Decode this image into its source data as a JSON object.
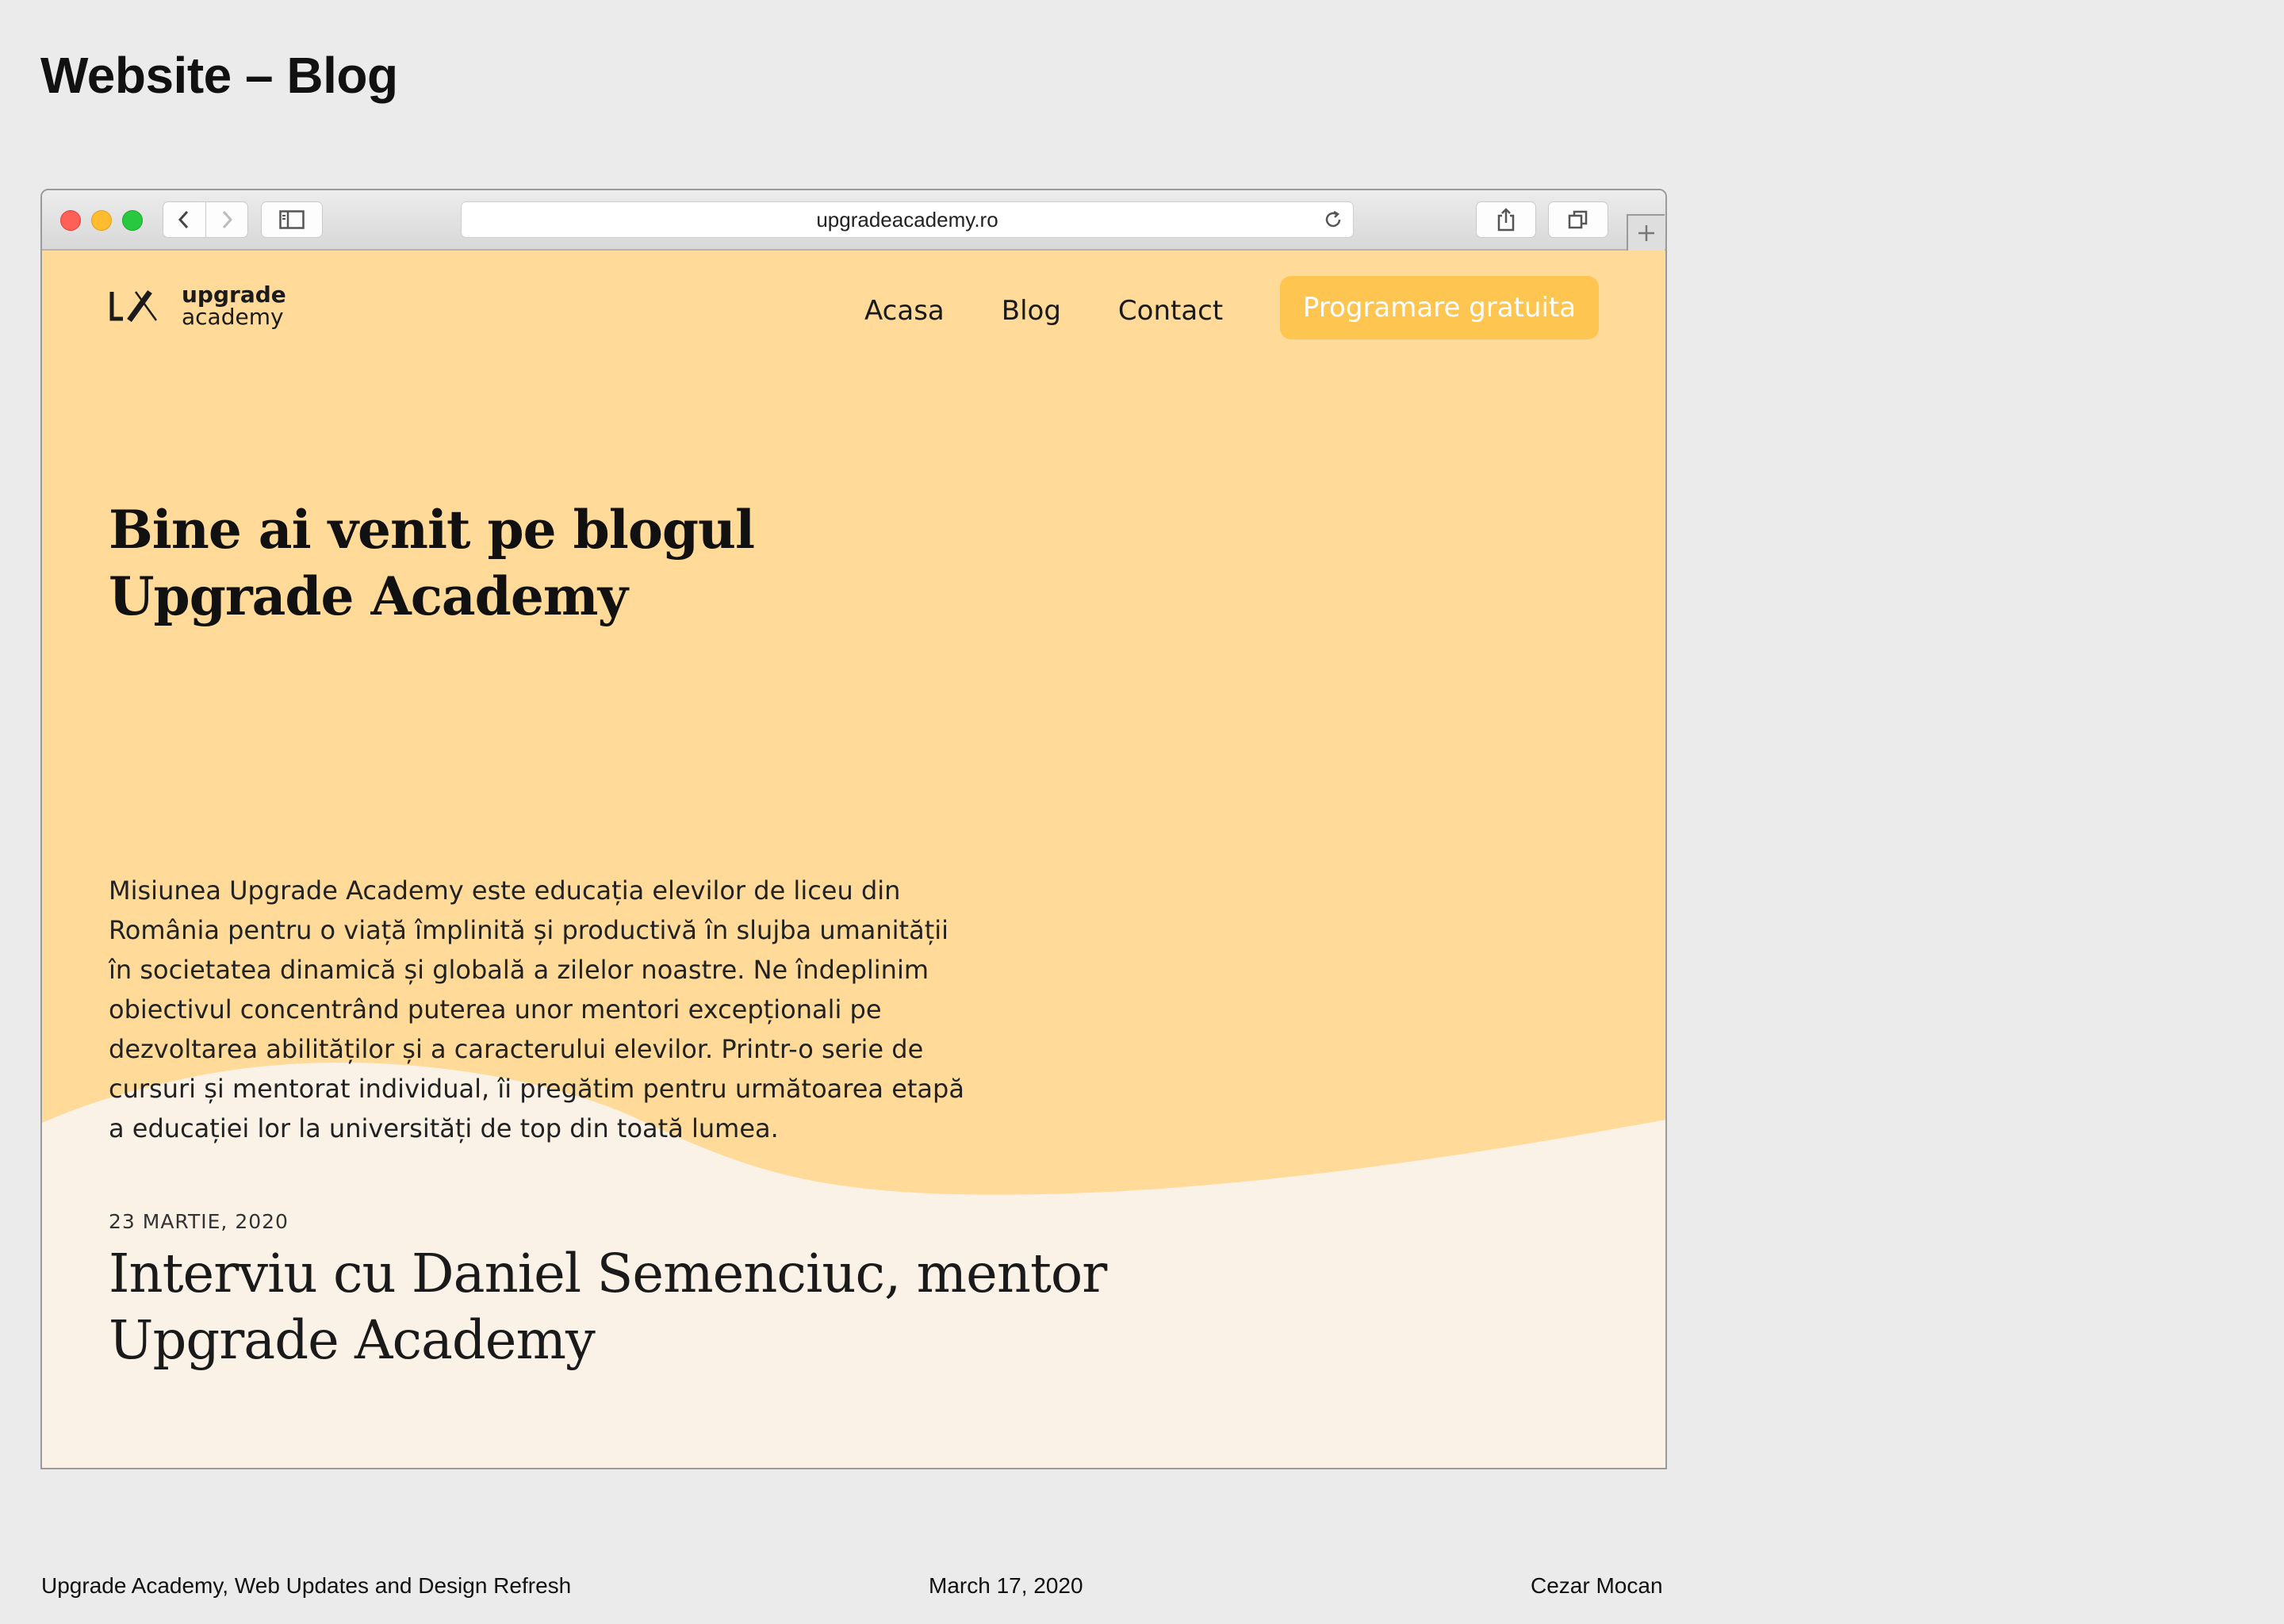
{
  "page": {
    "title": "Website – Blog"
  },
  "browser": {
    "url": "upgradeacademy.ro",
    "icons": {
      "back": "chevron-left-icon",
      "forward": "chevron-right-icon",
      "sidebar": "sidebar-icon",
      "reload": "reload-icon",
      "share": "share-icon",
      "tabs": "tabs-overview-icon",
      "new_tab": "plus-icon"
    }
  },
  "site": {
    "colors": {
      "hero_bg": "#ffda98",
      "page_bg": "#faf2e6",
      "cta_bg": "#ffc551"
    },
    "logo": {
      "line1": "upgrade",
      "line2": "academy"
    },
    "nav": [
      {
        "label": "Acasa"
      },
      {
        "label": "Blog"
      },
      {
        "label": "Contact"
      }
    ],
    "cta_label": "Programare gratuita",
    "hero": {
      "title_line1": "Bine ai venit pe blogul",
      "title_line2": "Upgrade Academy",
      "paragraph": "Misiunea Upgrade Academy este educația elevilor de liceu din România pentru o viață împlinită și productivă în slujba umanității în societatea dinamică și globală a zilelor noastre. Ne îndeplinim obiectivul concentrând puterea unor mentori excepționali pe dezvoltarea abilităților și a caracterului elevilor. Printr-o serie de cursuri și mentorat individual, îi pregătim pentru următoarea etapă a educației lor la universități de top din toată lumea."
    },
    "post": {
      "date": "23 MARTIE, 2020",
      "title_line1": "Interviu cu Daniel Semenciuc, mentor",
      "title_line2": "Upgrade Academy"
    }
  },
  "footer": {
    "left": "Upgrade Academy, Web Updates and Design Refresh",
    "center": "March 17, 2020",
    "right": "Cezar Mocan"
  }
}
